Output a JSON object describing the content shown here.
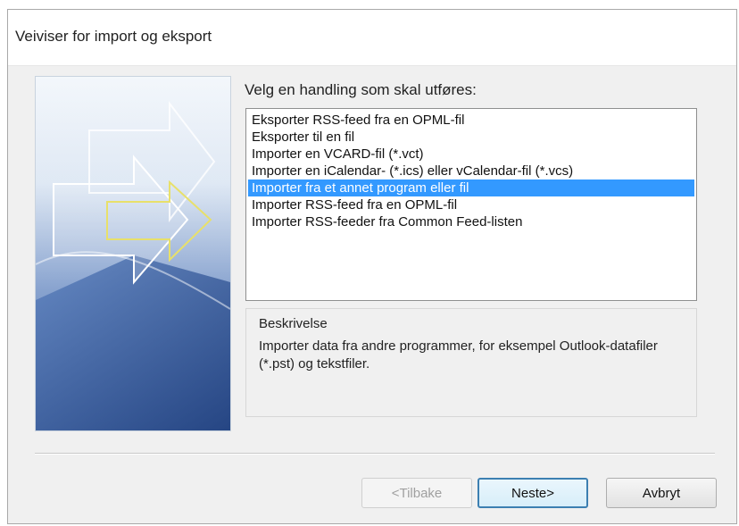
{
  "window": {
    "title": "Veiviser for import og eksport"
  },
  "prompt": "Velg en handling som skal utføres:",
  "actions": {
    "items": [
      {
        "label": "Eksporter RSS-feed fra en OPML-fil",
        "selected": false
      },
      {
        "label": "Eksporter til en fil",
        "selected": false
      },
      {
        "label": "Importer en VCARD-fil (*.vct)",
        "selected": false
      },
      {
        "label": "Importer en iCalendar- (*.ics) eller vCalendar-fil (*.vcs)",
        "selected": false
      },
      {
        "label": "Importer fra et annet program eller fil",
        "selected": true
      },
      {
        "label": "Importer RSS-feed fra en OPML-fil",
        "selected": false
      },
      {
        "label": "Importer RSS-feeder fra Common Feed-listen",
        "selected": false
      }
    ]
  },
  "description": {
    "title": "Beskrivelse",
    "text": "Importer data fra andre programmer, for eksempel Outlook-datafiler (*.pst) og tekstfiler."
  },
  "buttons": {
    "back_label": "<Tilbake",
    "next_label": "Neste>",
    "cancel_label": "Avbryt"
  },
  "colors": {
    "selection": "#3399ff",
    "dialog_bg": "#f0f0f0"
  }
}
